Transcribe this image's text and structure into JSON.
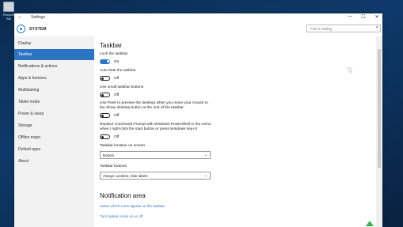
{
  "desktop": {
    "icon_label": "Recycle Bin"
  },
  "window": {
    "title": "Settings",
    "back_glyph": "←",
    "min_glyph": "—",
    "max_glyph": "☐",
    "close_glyph": "✕"
  },
  "header": {
    "section": "SYSTEM",
    "search_placeholder": "Find a setting",
    "search_icon": "⌕"
  },
  "sidebar": {
    "items": [
      {
        "label": "Display"
      },
      {
        "label": "Taskbar"
      },
      {
        "label": "Notifications & actions"
      },
      {
        "label": "Apps & features"
      },
      {
        "label": "Multitasking"
      },
      {
        "label": "Tablet mode"
      },
      {
        "label": "Power & sleep"
      },
      {
        "label": "Storage"
      },
      {
        "label": "Offline maps"
      },
      {
        "label": "Default apps"
      },
      {
        "label": "About"
      }
    ]
  },
  "main": {
    "heading": "Taskbar",
    "settings": [
      {
        "label": "Lock the taskbar",
        "state": "On"
      },
      {
        "label": "Auto-hide the taskbar",
        "state": "Off"
      },
      {
        "label": "Use small taskbar buttons",
        "state": "Off"
      },
      {
        "label_line1": "Use Peek to preview the desktop when you move your mouse to",
        "label_line2": "the Show desktop button at the end of the taskbar",
        "state": "Off"
      },
      {
        "label_line1": "Replace Command Prompt with Windows PowerShell in the menu",
        "label_line2": "when I right-click the start button or press Windows key+X",
        "state": "Off"
      }
    ],
    "location_label": "Taskbar location on screen",
    "location_value": "Bottom",
    "buttons_label": "Taskbar buttons",
    "buttons_value": "Always combine, hide labels",
    "chevron_glyph": "⌄",
    "notification_heading": "Notification area",
    "link1": "Select which icons appear on the taskbar",
    "link2": "Turn system icons on or off"
  },
  "colors": {
    "accent": "#2d74c4",
    "sidebar_bg": "#f2f2f2",
    "desktop": "#0e3a6b"
  }
}
